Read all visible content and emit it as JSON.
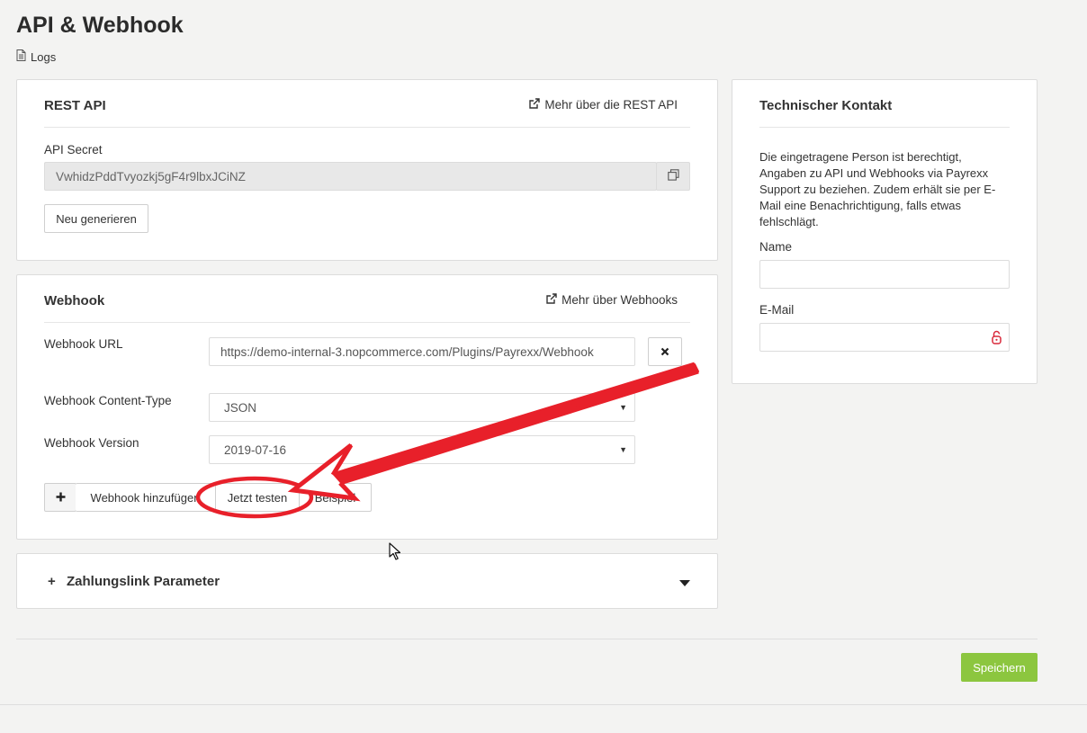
{
  "page": {
    "title": "API & Webhook",
    "logs_label": "Logs"
  },
  "rest_api": {
    "title": "REST API",
    "more_link": "Mehr über die REST API",
    "secret_label": "API Secret",
    "secret_value": "VwhidzPddTvyozkj5gF4r9lbxJCiNZ",
    "regenerate_label": "Neu generieren"
  },
  "webhook": {
    "title": "Webhook",
    "more_link": "Mehr über Webhooks",
    "url_label": "Webhook URL",
    "url_value": "https://demo-internal-3.nopcommerce.com/Plugins/Payrexx/Webhook",
    "content_type_label": "Webhook Content-Type",
    "content_type_value": "JSON",
    "version_label": "Webhook Version",
    "version_value": "2019-07-16",
    "add_label": "Webhook hinzufügen",
    "test_label": "Jetzt testen",
    "example_label": "Beispiel"
  },
  "zahlungslink": {
    "title": "Zahlungslink Parameter"
  },
  "contact": {
    "title": "Technischer Kontakt",
    "description": "Die eingetragene Person ist berechtigt, Angaben zu API und Webhooks via Payrexx Support zu beziehen. Zudem erhält sie per E-Mail eine Benachrichtigung, falls etwas fehlschlägt.",
    "name_label": "Name",
    "name_value": "",
    "email_label": "E-Mail",
    "email_value": ""
  },
  "footer": {
    "save_label": "Speichern"
  },
  "colors": {
    "save_button": "#8cc63f",
    "annotation": "#e8202a",
    "lock_icon": "#d9283a"
  },
  "icons": [
    "document-icon",
    "external-link-icon",
    "copy-icon",
    "close-icon",
    "plus-icon",
    "caret-down-icon",
    "lock-icon",
    "mouse-cursor-icon"
  ]
}
